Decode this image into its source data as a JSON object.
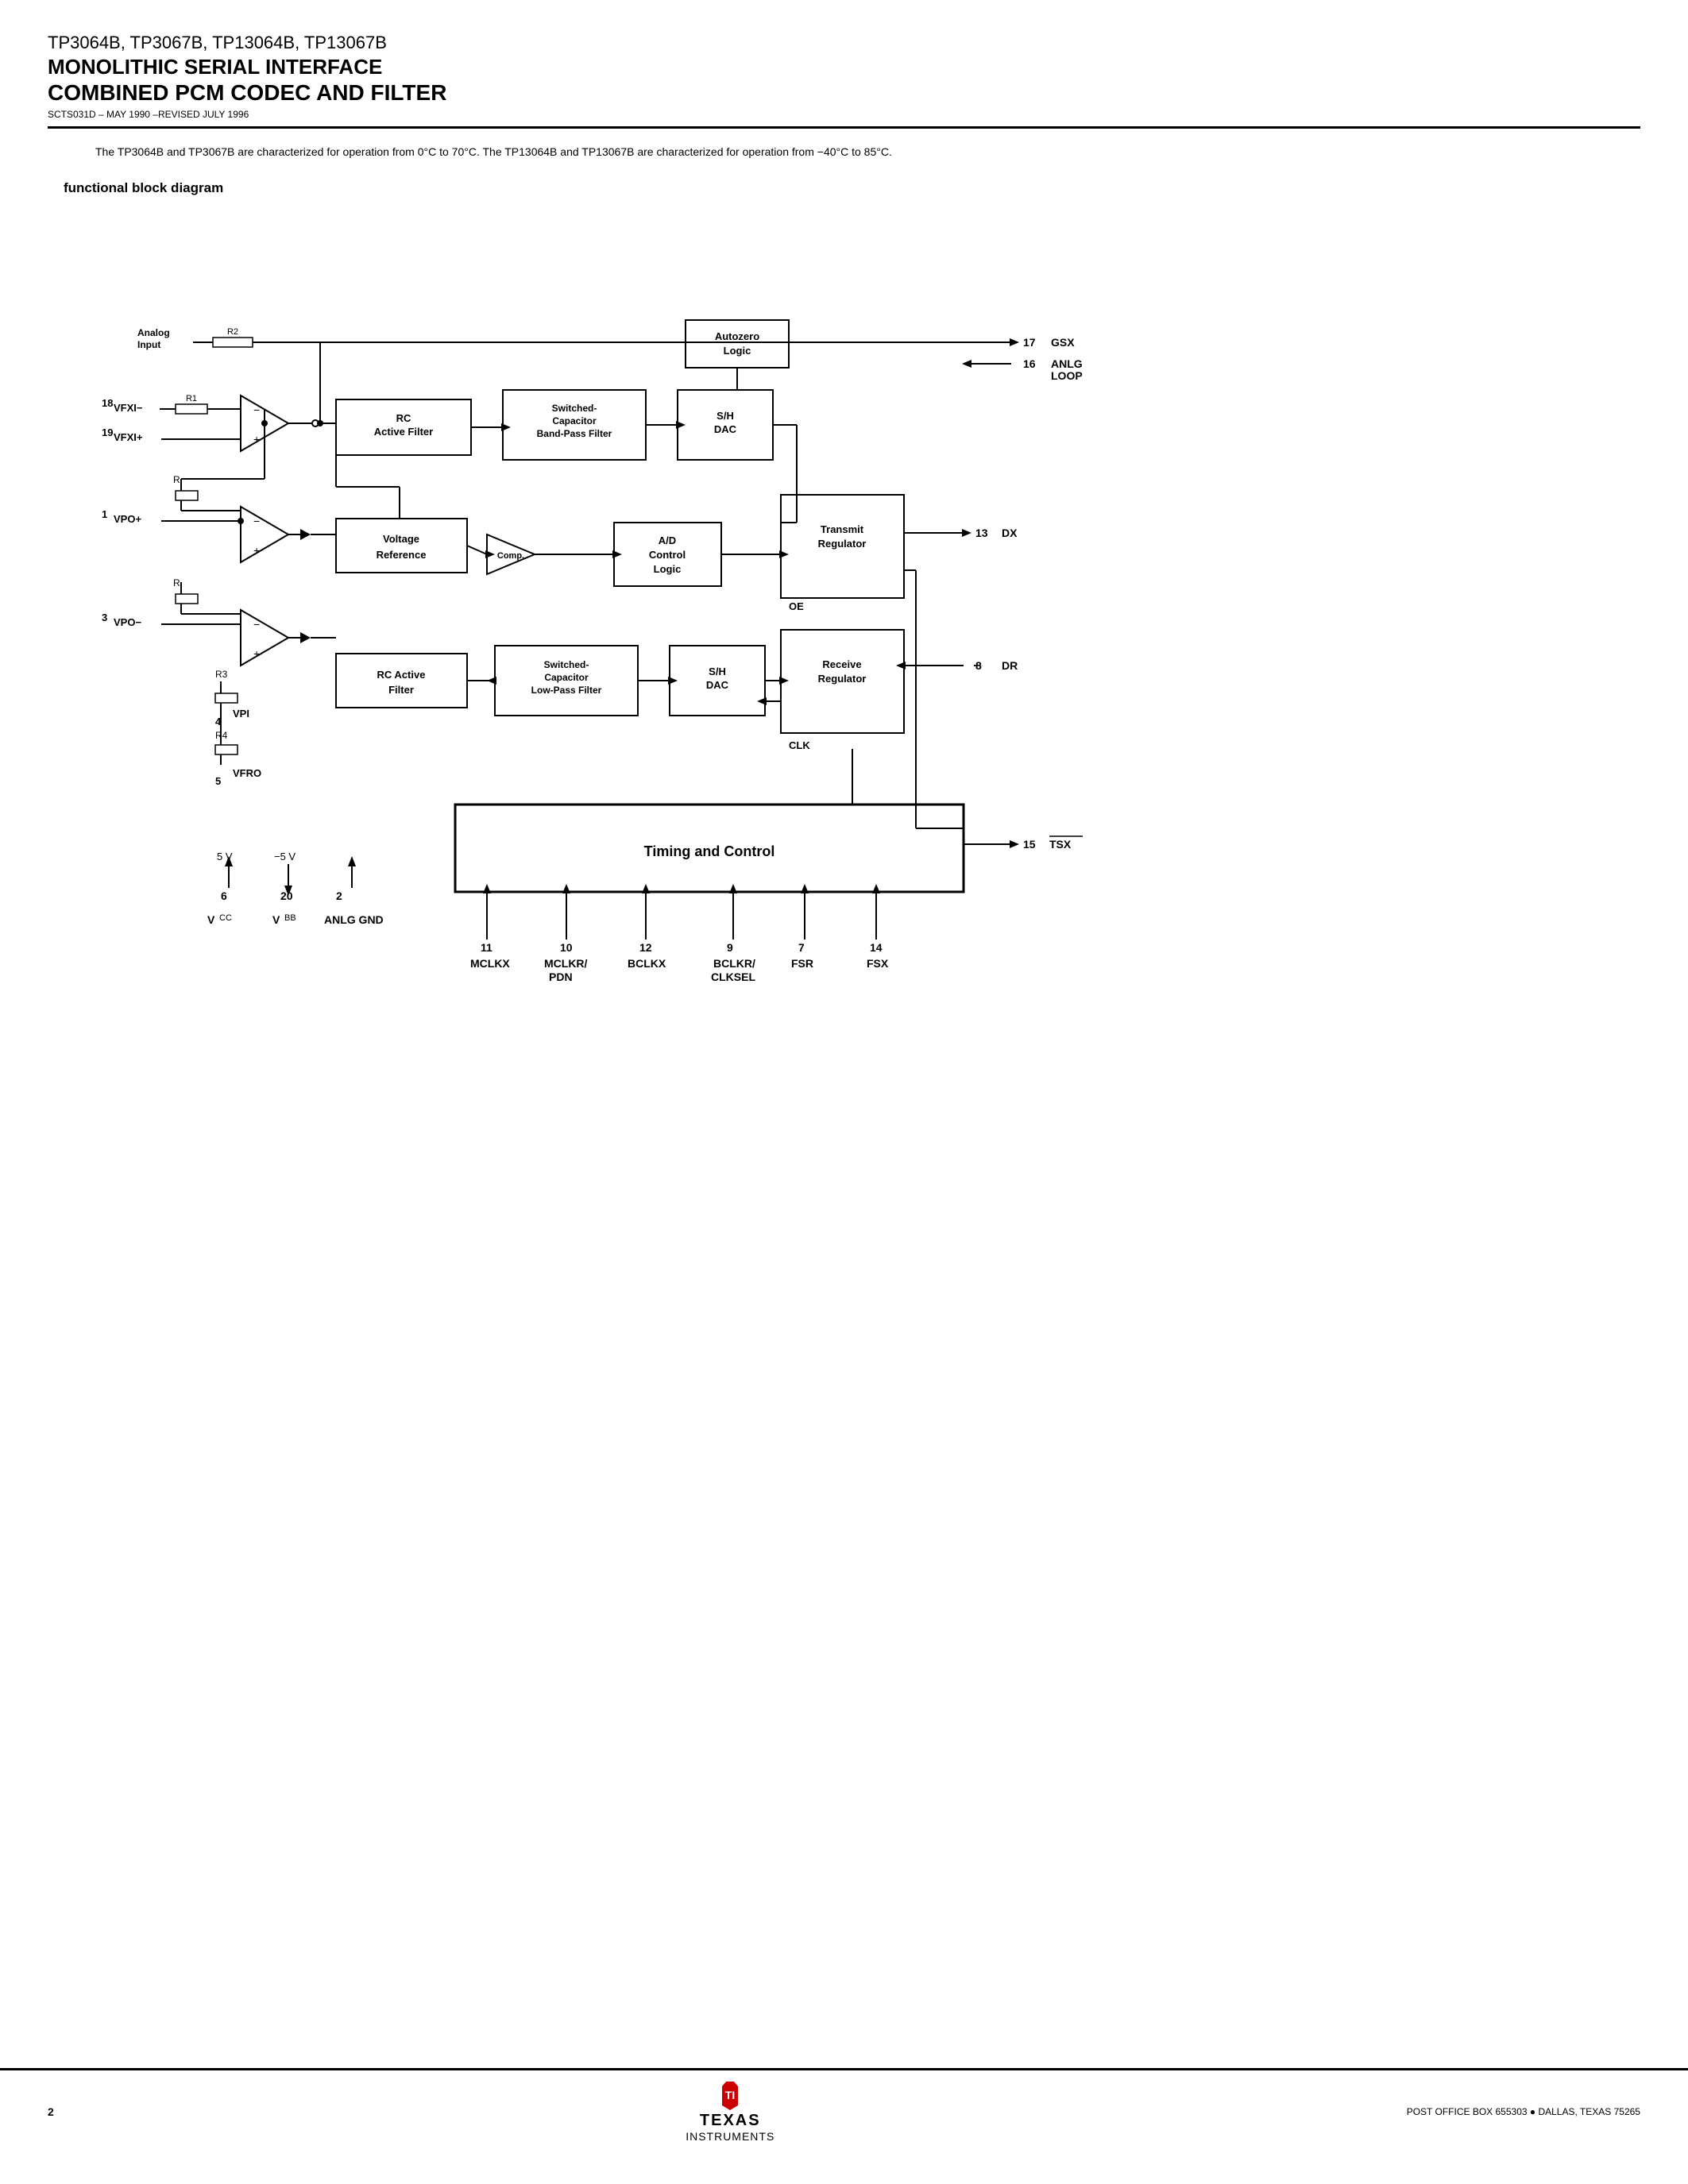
{
  "header": {
    "part_numbers": "TP3064B, TP3067B, TP13064B, TP13067B",
    "title1": "MONOLITHIC SERIAL INTERFACE",
    "title2": "COMBINED PCM CODEC AND FILTER",
    "doc_id": "SCTS031D – MAY 1990 –REVISED JULY 1996"
  },
  "description": "The TP3064B and TP3067B are characterized for operation from 0°C to 70°C. The TP13064B and TP13067B are characterized for operation from −40°C to 85°C.",
  "section": "functional block diagram",
  "blocks": {
    "rc_active_filter": "RC\nActive Filter",
    "switched_cap_bpf": "Switched-\nCapacitor\nBand-Pass Filter",
    "sh_dac_top": "S/H\nDAC",
    "autozero_logic": "Autozero\nLogic",
    "voltage_ref": "Voltage\nReference",
    "comparator": "Comparator",
    "ad_control": "A/D\nControl\nLogic",
    "transmit_reg": "Transmit\nRegulator",
    "receive_reg": "Receive\nRegulator",
    "rc_active_filter2": "RC Active\nFilter",
    "switched_cap_lpf": "Switched-\nCapacitor\nLow-Pass Filter",
    "sh_dac_bot": "S/H\nDAC",
    "timing_control": "Timing and Control"
  },
  "pins": {
    "gsx": {
      "num": "17",
      "label": "GSX"
    },
    "anlg_loop": {
      "num": "16",
      "label": "ANLG\nLOOP"
    },
    "dx": {
      "num": "13",
      "label": "DX"
    },
    "oe": {
      "label": "OE"
    },
    "dr": {
      "num": "8",
      "label": "DR"
    },
    "clk": {
      "label": "CLK"
    },
    "tsx": {
      "num": "15",
      "label": "TSX"
    },
    "mclkx": {
      "num": "11",
      "label": "MCLKX"
    },
    "mclkr_pdn": {
      "num": "10",
      "label": "MCLKR/\nPDN"
    },
    "bclkx": {
      "num": "12",
      "label": "BCLKX"
    },
    "bclkr_clksel": {
      "num": "9",
      "label": "BCLKR/\nCLKSEL"
    },
    "fsr": {
      "num": "7",
      "label": "FSR"
    },
    "fsx": {
      "num": "14",
      "label": "FSX"
    },
    "vpo_plus": {
      "num": "1",
      "label": "VPO+"
    },
    "vpo_minus": {
      "num": "3",
      "label": "VPO−"
    },
    "vpi": {
      "num": "4",
      "label": "VPI"
    },
    "vfxi_minus": {
      "num": "18",
      "label": "VFXI−"
    },
    "vfxi_plus": {
      "num": "19",
      "label": "VFXI+"
    },
    "vcc": {
      "num": "6",
      "label": "V CC"
    },
    "vbb": {
      "num": "20",
      "label": "V BB"
    },
    "anlg_gnd": {
      "num": "2",
      "label": "ANLG GND"
    },
    "vfro": {
      "num": "5",
      "label": "VFRO"
    }
  },
  "supply": {
    "vcc_val": "5 V",
    "vbb_val": "−5 V",
    "anlg_gnd_val": "ANLG GND"
  },
  "footer": {
    "page_num": "2",
    "company": "TEXAS\nINSTRUMENTS",
    "address": "POST OFFICE BOX 655303 ● DALLAS, TEXAS 75265"
  }
}
